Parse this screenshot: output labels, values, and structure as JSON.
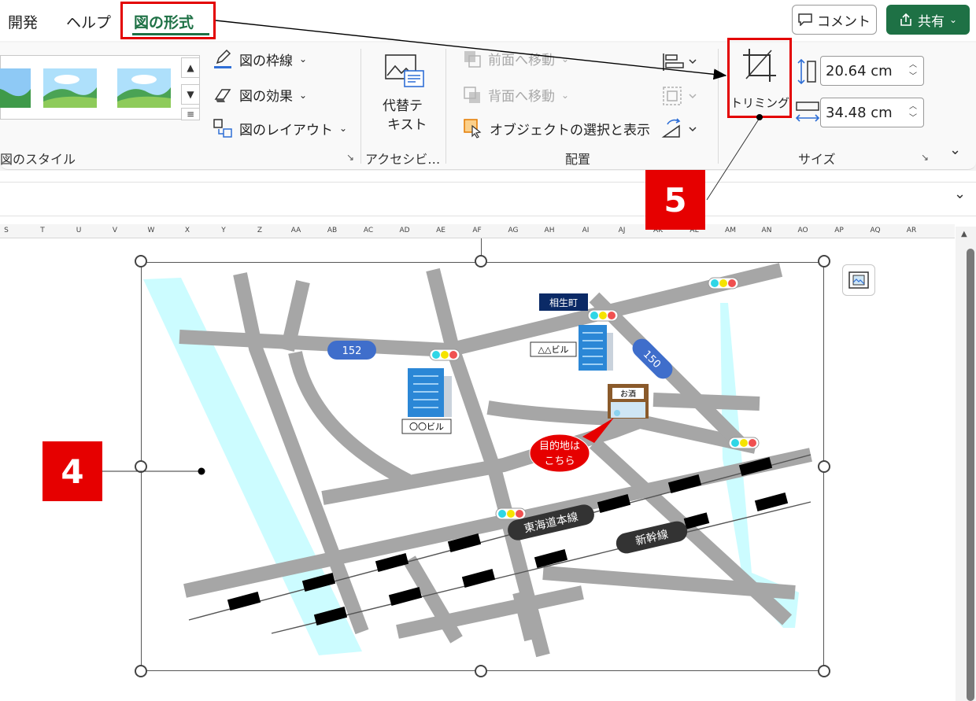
{
  "tabs": [
    {
      "label": "開発"
    },
    {
      "label": "ヘルプ"
    },
    {
      "label": "図の形式",
      "active": true
    }
  ],
  "header": {
    "comment_label": "コメント",
    "share_label": "共有"
  },
  "picture_styles": {
    "border_label": "図の枠線",
    "effects_label": "図の効果",
    "layout_label": "図のレイアウト",
    "group_label": "図のスタイル"
  },
  "accessibility": {
    "alt_text_line1": "代替テ",
    "alt_text_line2": "キスト",
    "group_label": "アクセシビ…"
  },
  "arrange": {
    "bring_forward": "前面へ移動",
    "send_backward": "背面へ移動",
    "selection_pane": "オブジェクトの選択と表示",
    "group_label": "配置"
  },
  "size": {
    "crop_label": "トリミング",
    "height_value": "20.64 cm",
    "width_value": "34.48 cm",
    "group_label": "サイズ"
  },
  "column_headers": [
    "S",
    "T",
    "U",
    "V",
    "W",
    "X",
    "Y",
    "Z",
    "AA",
    "AB",
    "AC",
    "AD",
    "AE",
    "AF",
    "AG",
    "AH",
    "AI",
    "AJ",
    "AK",
    "AL",
    "AM",
    "AN",
    "AO",
    "AP",
    "AQ",
    "AR"
  ],
  "steps": {
    "step4": "4",
    "step5": "5"
  },
  "map": {
    "station_label": "相生町",
    "route_152": "152",
    "route_150": "150",
    "building_a": "〇〇ビル",
    "building_b": "△△ビル",
    "shop_sign": "お酒",
    "destination_line1": "目的地は",
    "destination_line2": "こちら",
    "rail_tokaido": "東海道本線",
    "rail_shinkansen": "新幹線"
  },
  "colors": {
    "accent_green": "#1e7145",
    "highlight_red": "#e30000",
    "step_red": "#e60000",
    "road_gray": "#a6a6a6",
    "river_cyan": "#ccfcff",
    "route_blue": "#3f6ecb"
  }
}
